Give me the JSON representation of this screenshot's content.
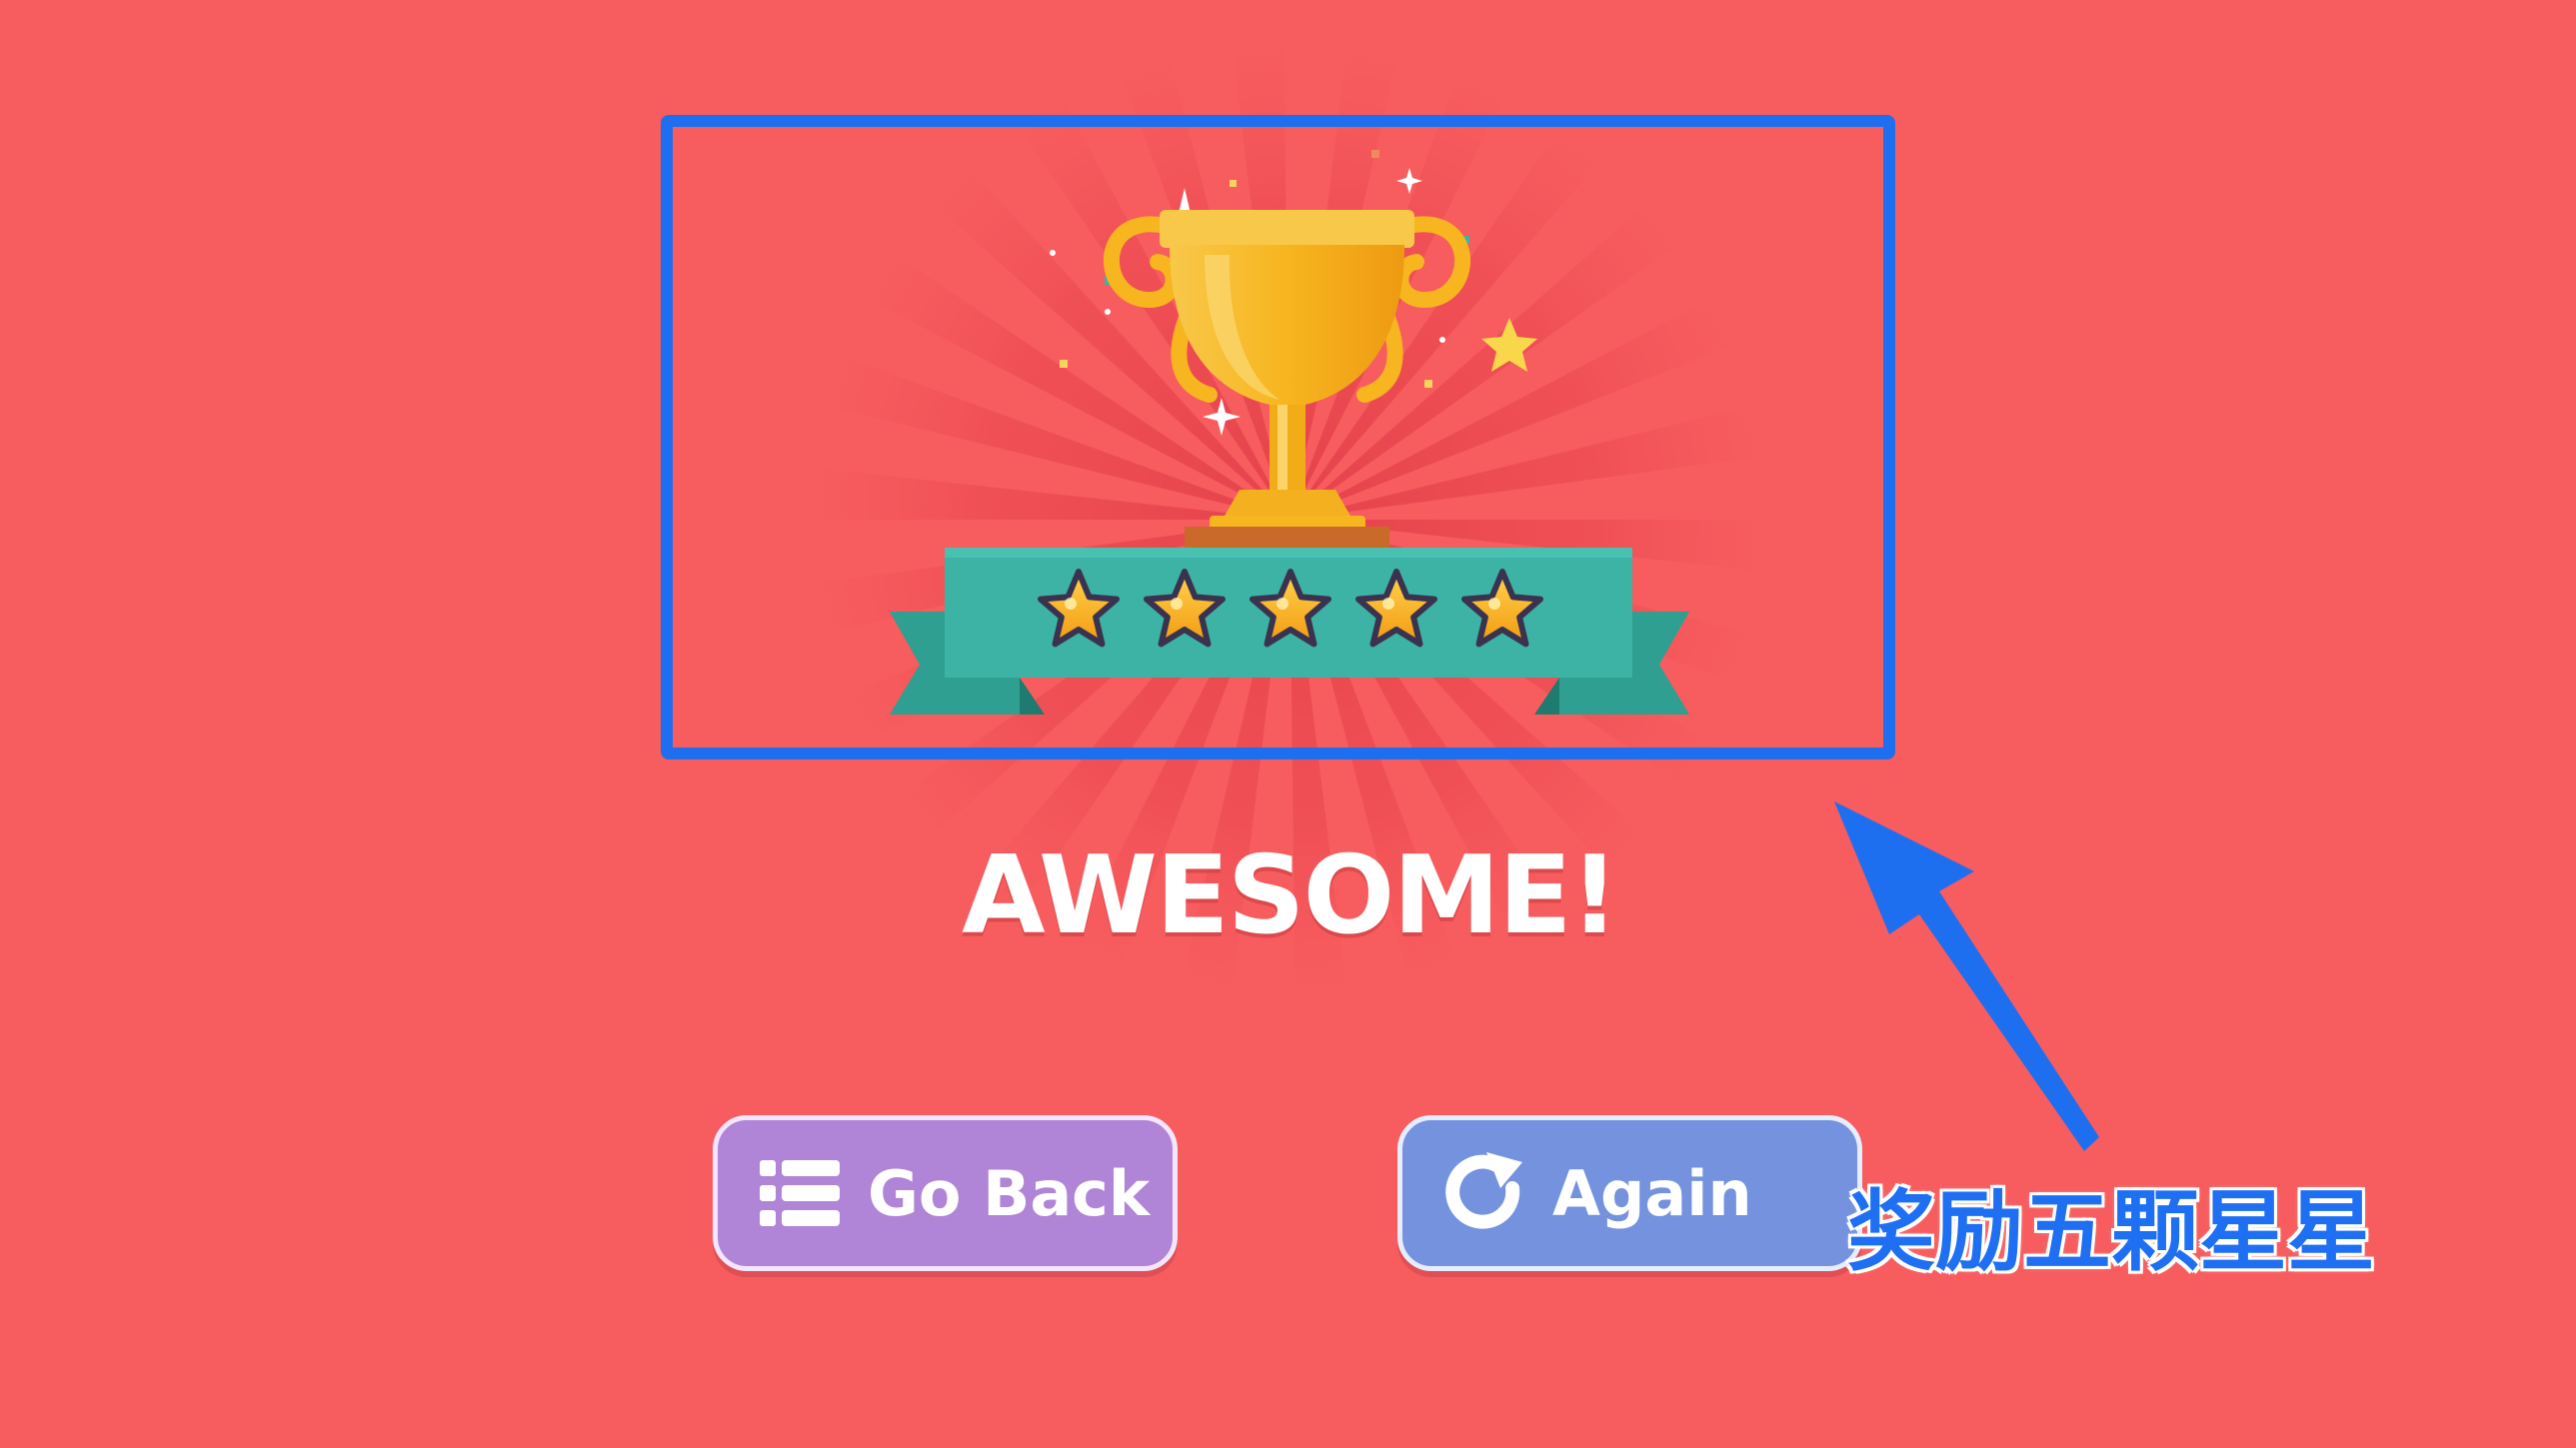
{
  "result": {
    "title": "AWESOME!",
    "stars_earned": 5,
    "stars_total": 5
  },
  "buttons": {
    "back_label": "Go Back",
    "back_icon": "list-icon",
    "again_label": "Again",
    "again_icon": "replay-icon"
  },
  "annotation": {
    "caption": "奖励五颗星星",
    "highlight_color": "#1e6ff0",
    "arrow_color": "#1e6ff0"
  },
  "colors": {
    "background": "#f75c5e",
    "back_button": "#b084d6",
    "again_button": "#7592de",
    "ribbon": "#3db3a5",
    "trophy": "#f6b31e",
    "star": "#f5a81c"
  }
}
